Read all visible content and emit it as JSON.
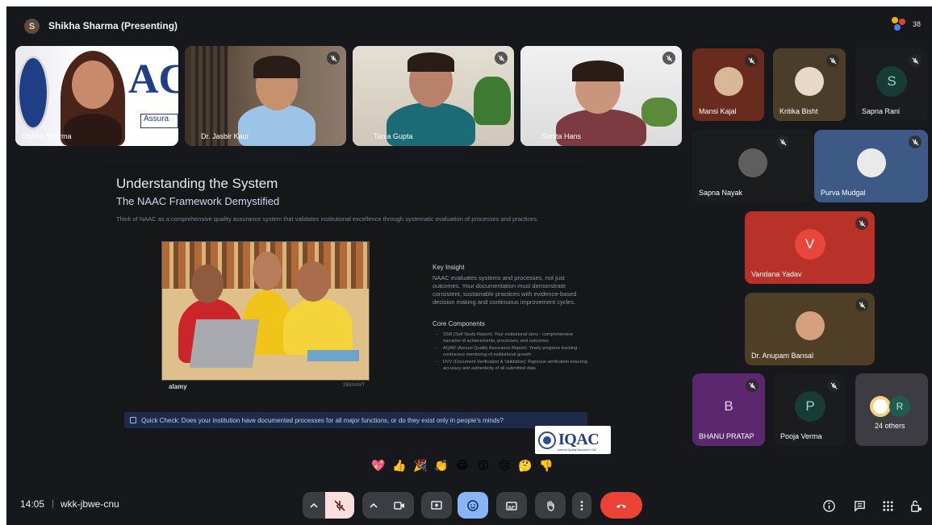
{
  "presenter": {
    "avatar_letter": "S",
    "label": "Shikha Sharma (Presenting)"
  },
  "participant_count": "38",
  "video_tiles": [
    {
      "name": "Shikha Sharma"
    },
    {
      "name": "Dr. Jasbir Kaur"
    },
    {
      "name": "Tania Gupta"
    },
    {
      "name": "Sunita Hans"
    }
  ],
  "side_tiles": [
    {
      "name": "Mansi Kajal",
      "color": "#6a2b1f"
    },
    {
      "name": "Kritika Bisht",
      "color": "#4a3e2a"
    },
    {
      "name": "Sapna Rani",
      "letter": "S",
      "color": "#173c36"
    },
    {
      "name": "Sapna Nayak",
      "color": "#1b1c1e"
    },
    {
      "name": "Purva Mudgal",
      "color": "#3d5a86"
    },
    {
      "name": "Vandana Yadav",
      "letter": "V",
      "color": "#b8322a"
    },
    {
      "name": "Dr. Anupam Bansal",
      "color": "#4e3f26"
    },
    {
      "name": "BHANU PRATAP",
      "letter": "B",
      "color": "#5b2870"
    },
    {
      "name": "Pooja Verma",
      "letter": "P",
      "color": "#173c36"
    },
    {
      "name": "24 others",
      "letter": "R",
      "color": "#3c3c42"
    }
  ],
  "slide": {
    "title": "Understanding the System",
    "subtitle": "The NAAC Framework Demystified",
    "intro": "Think of NAAC as a comprehensive quality assurance system that validates institutional excellence through systematic evaluation of processes and practices.",
    "photo_credit": "alamy",
    "photo_id": "2B8X4WT",
    "key_insight_heading": "Key Insight",
    "key_insight_text": "NAAC evaluates systems and processes, not just outcomes. Your documentation must demonstrate consistent, sustainable practices with evidence-based decision making and continuous improvement cycles.",
    "core_heading": "Core Components",
    "core_items": [
      "SSR (Self Study Report): Your institutional story - comprehensive narrative of achievements, processes, and outcomes",
      "AQAR (Annual Quality Assurance Report): Yearly progress tracking - continuous monitoring of institutional growth",
      "DVV (Document Verification & Validation): Rigorous verification ensuring accuracy and authenticity of all submitted data"
    ],
    "quick_check": "Quick Check: Does your institution have documented processes for all major functions, or do they exist only in people's minds?",
    "logo_text": "IQAC",
    "logo_tagline": "Internal Quality Assurance Cell"
  },
  "reactions": [
    "💖",
    "👍",
    "🎉",
    "👏",
    "😂",
    "😮",
    "😢",
    "🤔",
    "👎"
  ],
  "meeting": {
    "time": "14:05",
    "separator": "|",
    "code": "wkk-jbwe-cnu"
  },
  "colors": {
    "background": "#17181b",
    "control": "#3b3d42",
    "end_call": "#ea4335",
    "mic_off": "#f9dede",
    "emoji_active": "#8ab4f8"
  }
}
